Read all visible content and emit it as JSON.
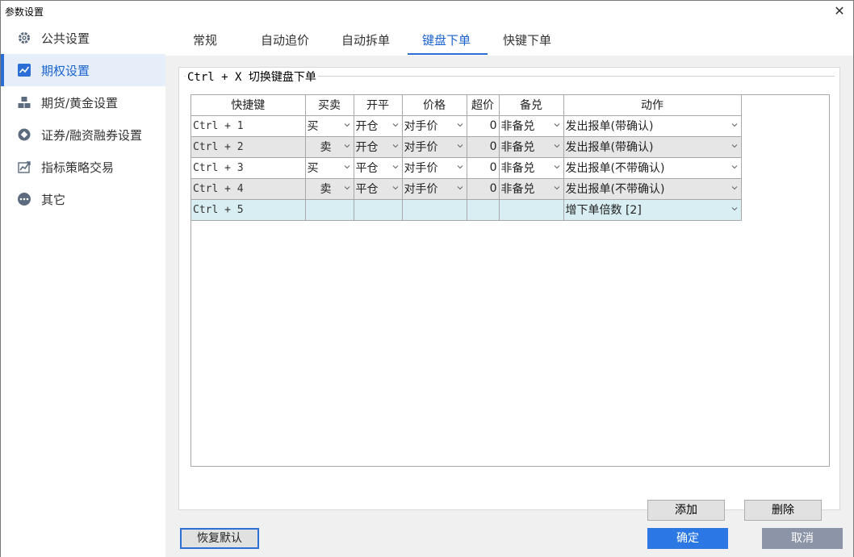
{
  "window": {
    "title": "参数设置",
    "close": "✕"
  },
  "sidebar": {
    "items": [
      {
        "label": "公共设置",
        "icon": "gear-icon"
      },
      {
        "label": "期权设置",
        "icon": "option-chart-icon",
        "active": true
      },
      {
        "label": "期货/黄金设置",
        "icon": "gold-bars-icon"
      },
      {
        "label": "证券/融资融券设置",
        "icon": "securities-icon"
      },
      {
        "label": "指标策略交易",
        "icon": "strategy-chart-icon"
      },
      {
        "label": "其它",
        "icon": "more-icon"
      }
    ]
  },
  "tabs": [
    {
      "label": "常规"
    },
    {
      "label": "自动追价"
    },
    {
      "label": "自动拆单"
    },
    {
      "label": "键盘下单",
      "active": true
    },
    {
      "label": "快键下单"
    }
  ],
  "group": {
    "title": "Ctrl + X 切换键盘下单"
  },
  "table": {
    "headers": [
      "快捷键",
      "买卖",
      "开平",
      "价格",
      "超价",
      "备兑",
      "动作"
    ],
    "rows": [
      {
        "key": "Ctrl + 1",
        "side": "买",
        "openclose": "开仓",
        "price": "对手价",
        "over": "0",
        "covered": "非备兑",
        "action": "发出报单(带确认)"
      },
      {
        "key": "Ctrl + 2",
        "side": "卖",
        "openclose": "开仓",
        "price": "对手价",
        "over": "0",
        "covered": "非备兑",
        "action": "发出报单(带确认)"
      },
      {
        "key": "Ctrl + 3",
        "side": "买",
        "openclose": "平仓",
        "price": "对手价",
        "over": "0",
        "covered": "非备兑",
        "action": "发出报单(不带确认)"
      },
      {
        "key": "Ctrl + 4",
        "side": "卖",
        "openclose": "平仓",
        "price": "对手价",
        "over": "0",
        "covered": "非备兑",
        "action": "发出报单(不带确认)"
      },
      {
        "key": "Ctrl + 5",
        "side": "",
        "openclose": "",
        "price": "",
        "over": "",
        "covered": "",
        "action": "增下单倍数 [2]"
      }
    ]
  },
  "buttons": {
    "add": "添加",
    "delete": "删除",
    "restore": "恢复默认",
    "ok": "确定",
    "cancel": "取消"
  },
  "colors": {
    "accent": "#2b6fd6",
    "active_bg": "#e6eef9",
    "selected_row": "#d9eef2",
    "cancel_bg": "#8b95a7"
  }
}
